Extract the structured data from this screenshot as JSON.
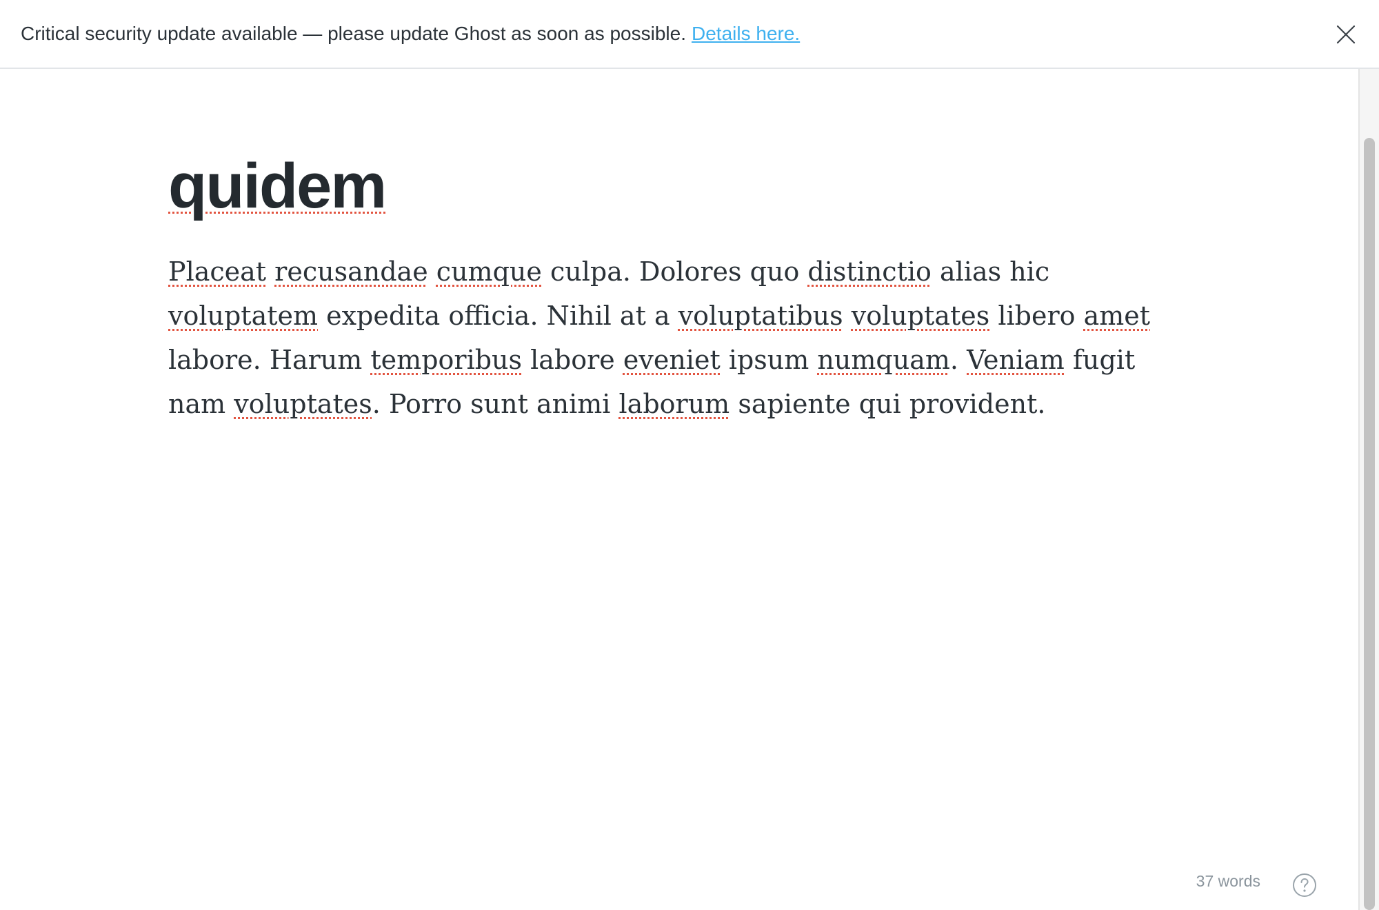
{
  "alert": {
    "message": "Critical security update available — please update Ghost as soon as possible.",
    "link_text": "Details here.",
    "link_color": "#3eb0ef",
    "close_icon": "close-icon"
  },
  "editor": {
    "title": "quidem",
    "body": "Placeat recusandae cumque culpa. Dolores quo distinctio alias hic voluptatem expedita officia. Nihil at a voluptatibus voluptates libero amet labore. Harum temporibus labore eveniet ipsum numquam. Veniam fugit nam voluptates. Porro sunt animi laborum sapiente qui provident.",
    "misspelled_words": [
      "quidem",
      "Placeat",
      "recusandae",
      "cumque",
      "distinctio",
      "voluptatem",
      "voluptatibus",
      "voluptates",
      "amet",
      "temporibus",
      "eveniet",
      "numquam",
      "Veniam",
      "laborum"
    ]
  },
  "footer": {
    "word_count": "37 words",
    "help_icon": "help-icon"
  }
}
